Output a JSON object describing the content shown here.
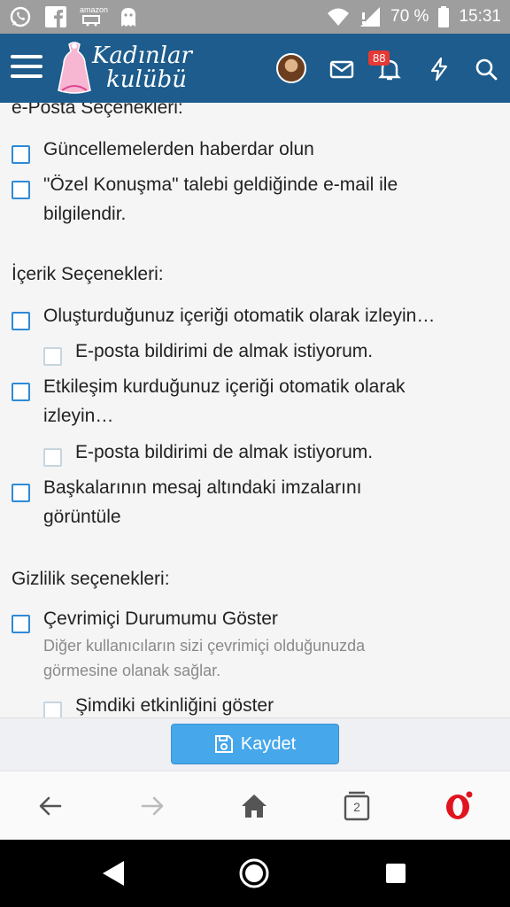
{
  "status_bar": {
    "battery": "70 %",
    "time": "15:31",
    "amazon_label": "amazon"
  },
  "app_bar": {
    "logo_line1": "Kadınlar",
    "logo_line2": "kulübü",
    "notification_count": "88"
  },
  "email_section": {
    "title": "e-Posta Seçenekleri:",
    "items": [
      {
        "label": "Güncellemelerden haberdar olun"
      },
      {
        "label_line1": "\"Özel Konuşma\" talebi geldiğinde e-mail ile",
        "label_line2": "bilgilendir."
      }
    ]
  },
  "content_section": {
    "title": "İçerik Seçenekleri:",
    "items": [
      {
        "label": "Oluşturduğunuz içeriği otomatik olarak izleyin…",
        "sub": "E-posta bildirimi de almak istiyorum."
      },
      {
        "label_line1": "Etkileşim kurduğunuz içeriği otomatik olarak",
        "label_line2": "izleyin…",
        "sub": "E-posta bildirimi de almak istiyorum."
      },
      {
        "label_line1": "Başkalarının mesaj altındaki imzalarını",
        "label_line2": "görüntüle"
      }
    ]
  },
  "privacy_section": {
    "title": "Gizlilik seçenekleri:",
    "items": [
      {
        "label": "Çevrimiçi Durumumu Göster",
        "hint_line1": "Diğer kullanıcıların sizi çevrimiçi olduğunuzda",
        "hint_line2": "görmesine olanak sağlar.",
        "sub": "Şimdiki etkinliğini göster"
      }
    ]
  },
  "save_button": {
    "label": "Kaydet"
  },
  "browser_bar": {
    "tabs_count": "2"
  },
  "colors": {
    "app_bar": "#1d5c8c",
    "checkbox": "#2e8ad8",
    "save_button": "#47a7eb",
    "status_bar": "#9e9e9e"
  },
  "icons": [
    "whatsapp-icon",
    "facebook-icon",
    "amazon-icon",
    "ghost-icon",
    "wifi-icon",
    "signal-icon",
    "battery-icon",
    "menu-icon",
    "avatar",
    "mail-icon",
    "bell-icon",
    "lightning-icon",
    "search-icon",
    "save-icon",
    "back-icon",
    "forward-icon",
    "home-icon",
    "tabs-icon",
    "opera-icon",
    "nav-back-icon",
    "nav-home-icon",
    "nav-recents-icon"
  ]
}
